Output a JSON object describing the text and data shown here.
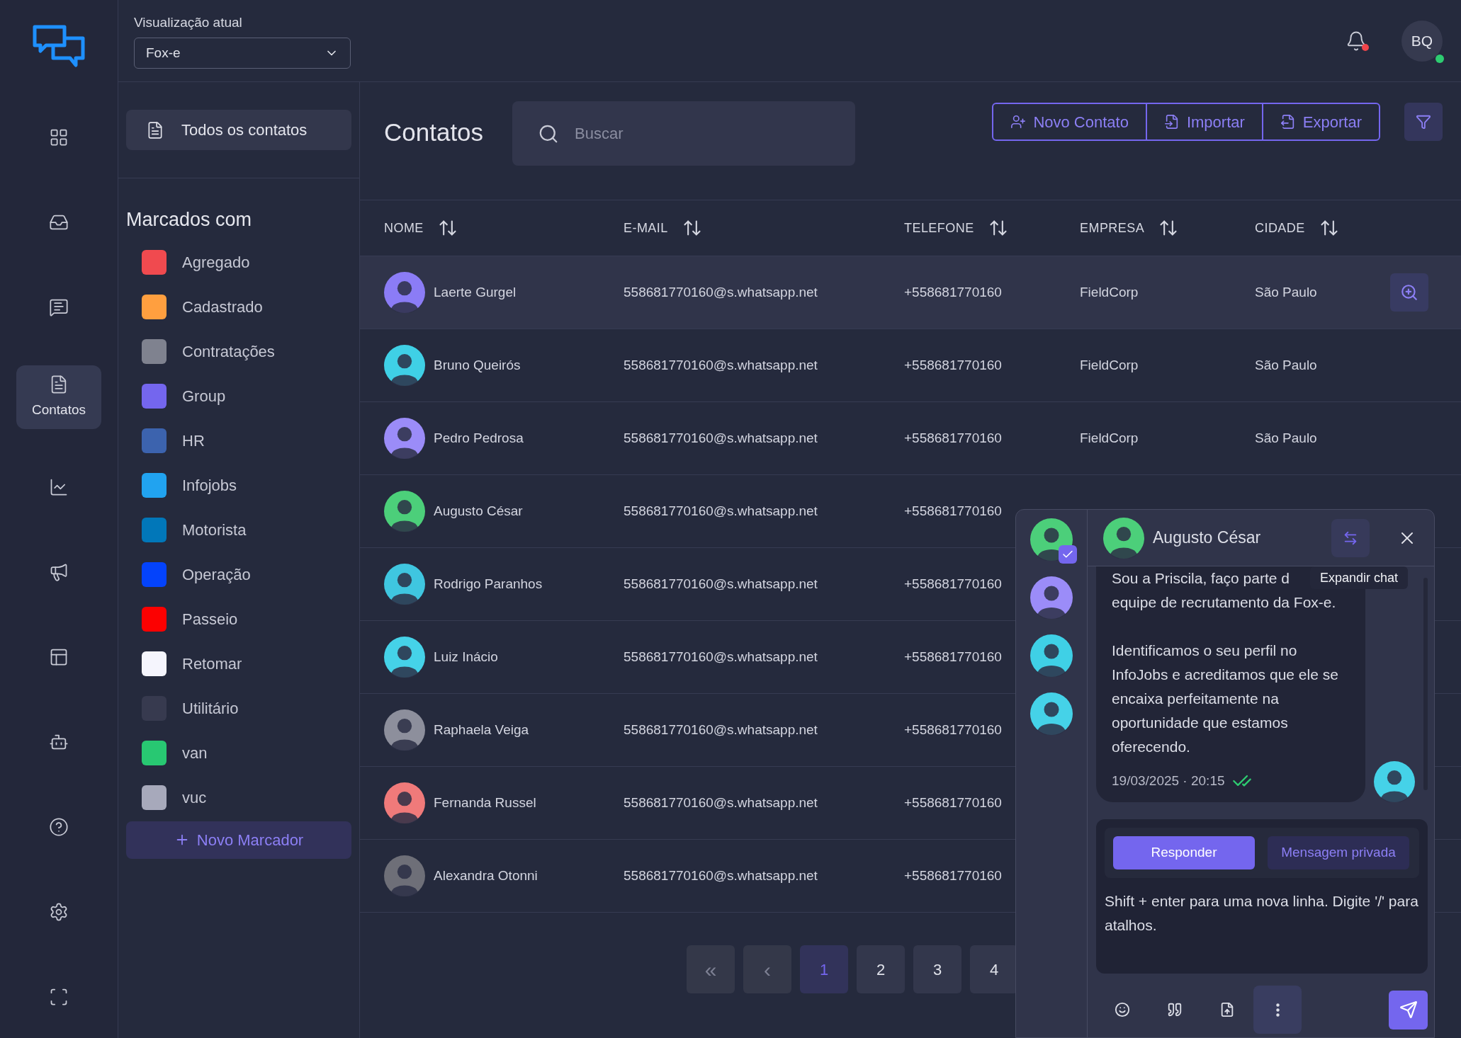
{
  "nav": {
    "items": [
      {
        "selected": false
      },
      {
        "selected": false
      },
      {
        "selected": false
      },
      {
        "label": "Contatos",
        "selected": true
      },
      {
        "selected": false
      },
      {
        "selected": false
      },
      {
        "selected": false
      },
      {
        "selected": false
      },
      {
        "selected": false
      },
      {
        "selected": false
      },
      {
        "selected": false
      }
    ]
  },
  "topbar": {
    "view_label": "Visualização atual",
    "view_value": "Fox-e",
    "notification_dot": true,
    "user_initials": "BQ",
    "user_online": true
  },
  "labels_panel": {
    "all_contacts": "Todos os contatos",
    "heading": "Marcados com",
    "tags": [
      {
        "name": "Agregado",
        "color": "#f04a4f"
      },
      {
        "name": "Cadastrado",
        "color": "#ff9f3f"
      },
      {
        "name": "Contratações",
        "color": "#7f828f"
      },
      {
        "name": "Group",
        "color": "#7466ee"
      },
      {
        "name": "HR",
        "color": "#3c63ae"
      },
      {
        "name": "Infojobs",
        "color": "#21a3f0"
      },
      {
        "name": "Motorista",
        "color": "#0177b9"
      },
      {
        "name": "Operação",
        "color": "#0443fb"
      },
      {
        "name": "Passeio",
        "color": "#fc0101"
      },
      {
        "name": "Retomar",
        "color": "#f5f5fd"
      },
      {
        "name": "Utilitário",
        "color": "#373a4f"
      },
      {
        "name": "van",
        "color": "#28c872"
      },
      {
        "name": "vuc",
        "color": "#a7a9bb"
      }
    ],
    "new_tag": "Novo Marcador"
  },
  "main": {
    "title": "Contatos",
    "search": {
      "placeholder": "Buscar"
    },
    "actions": [
      "Novo Contato",
      "Importar",
      "Exportar"
    ],
    "table": {
      "columns": [
        "NOME",
        "E-MAIL",
        "TELEFONE",
        "EMPRESA",
        "CIDADE"
      ],
      "rows": [
        {
          "name": "Laerte Gurgel",
          "email": "558681770160@s.whatsapp.net",
          "phone": "+558681770160",
          "company": "FieldCorp",
          "city": "São Paulo",
          "color": "#8b7cf6",
          "selected": true
        },
        {
          "name": "Bruno Queirós",
          "email": "558681770160@s.whatsapp.net",
          "phone": "+558681770160",
          "company": "FieldCorp",
          "city": "São Paulo",
          "color": "#3fd0e6",
          "selected": false
        },
        {
          "name": "Pedro Pedrosa",
          "email": "558681770160@s.whatsapp.net",
          "phone": "+558681770160",
          "company": "FieldCorp",
          "city": "São Paulo",
          "color": "#9b8cf8",
          "selected": false
        },
        {
          "name": "Augusto César",
          "email": "558681770160@s.whatsapp.net",
          "phone": "+558681770160",
          "color": "#4ccf7a",
          "selected": false
        },
        {
          "name": "Rodrigo Paranhos",
          "email": "558681770160@s.whatsapp.net",
          "phone": "+558681770160",
          "color": "#3fc6e0",
          "selected": false
        },
        {
          "name": "Luiz Inácio",
          "email": "558681770160@s.whatsapp.net",
          "phone": "+558681770160",
          "color": "#45d2e8",
          "selected": false
        },
        {
          "name": "Raphaela Veiga",
          "email": "558681770160@s.whatsapp.net",
          "phone": "+558681770160",
          "color": "#8d8f9c",
          "selected": false
        },
        {
          "name": "Fernanda Russel",
          "email": "558681770160@s.whatsapp.net",
          "phone": "+558681770160",
          "color": "#f07a7a",
          "selected": false
        },
        {
          "name": "Alexandra Otonni",
          "email": "558681770160@s.whatsapp.net",
          "phone": "+558681770160",
          "color": "#6e6f78",
          "selected": false
        }
      ]
    },
    "pagination": {
      "first": "«",
      "prev": "‹",
      "pages": [
        {
          "label": "1",
          "selected": true
        },
        {
          "label": "2",
          "selected": false
        },
        {
          "label": "3",
          "selected": false
        },
        {
          "label": "4",
          "selected": false
        }
      ]
    }
  },
  "chat": {
    "conversations": [
      {
        "color": "#4ccf7a",
        "selected": true
      },
      {
        "color": "#9b8cf8",
        "selected": false
      },
      {
        "color": "#3fd0e6",
        "selected": false
      },
      {
        "color": "#45d2e8",
        "selected": false
      }
    ],
    "contact_name": "Augusto César",
    "tooltip": "Expandir chat",
    "message": {
      "lines": [
        "Sou a Priscila, faço parte d",
        "equipe de recrutamento da Fox-e."
      ],
      "paragraph": "Identificamos o seu perfil no InfoJobs e acreditamos que ele se encaixa perfeitamente na oportunidade que estamos oferecendo.",
      "time": "19/03/2025 · 20:15",
      "read": true
    },
    "composer": {
      "modes": [
        {
          "label": "Responder",
          "selected": true
        },
        {
          "label": "Mensagem privada",
          "selected": false
        }
      ],
      "placeholder": "Shift + enter para uma nova linha. Digite '/' para atalhos."
    }
  }
}
